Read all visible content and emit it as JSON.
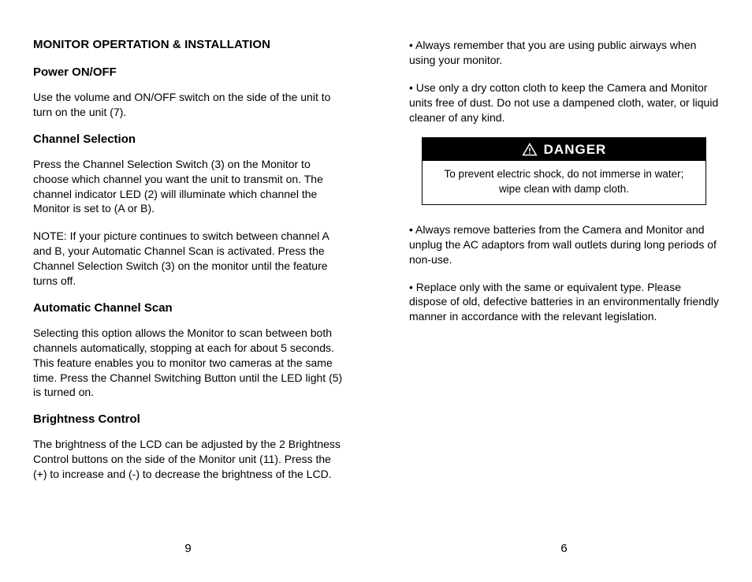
{
  "left": {
    "page_number": "9",
    "h1": "MONITOR OPERTATION & INSTALLATION",
    "sections": [
      {
        "heading": "Power ON/OFF",
        "paragraphs": [
          "Use the volume and ON/OFF switch on the side of the unit to turn on the unit (7)."
        ]
      },
      {
        "heading": "Channel Selection",
        "paragraphs": [
          "Press the Channel Selection Switch (3) on the Monitor to choose which channel you want the unit to transmit on. The channel indicator LED (2) will illuminate which channel the Monitor is set to (A or B).",
          "NOTE: If your picture continues to switch between channel A and B, your Automatic Channel Scan is activated. Press the Channel Selection Switch (3) on the monitor until the feature turns off."
        ]
      },
      {
        "heading": "Automatic Channel Scan",
        "paragraphs": [
          "Selecting this option allows the Monitor to scan between both channels automatically, stopping at each for about 5 seconds. This feature enables you to monitor two cameras at the same time. Press the Channel Switching Button until the LED light (5) is turned on."
        ]
      },
      {
        "heading": "Brightness Control",
        "paragraphs": [
          "The brightness of the LCD can be adjusted by the 2 Brightness Control buttons on the side of the Monitor unit (11). Press the (+) to increase and (-) to decrease the brightness of the LCD."
        ]
      }
    ]
  },
  "right": {
    "page_number": "6",
    "top_paragraphs": [
      "•  Always remember that you are using public airways when using your monitor.",
      "•  Use only a dry cotton cloth to keep the Camera and Monitor units free of dust. Do not use a dampened cloth, water, or liquid cleaner of any kind."
    ],
    "danger": {
      "label": "DANGER",
      "text": "To prevent electric shock, do not immerse in water; wipe clean with damp cloth."
    },
    "bottom_paragraphs": [
      "•  Always remove batteries from the Camera and Monitor and unplug the AC adaptors from wall outlets during long periods of non-use.",
      "•  Replace only with the same or equivalent type. Please dispose of old, defective batteries in an environmentally friendly manner in accordance with the relevant legislation."
    ]
  }
}
